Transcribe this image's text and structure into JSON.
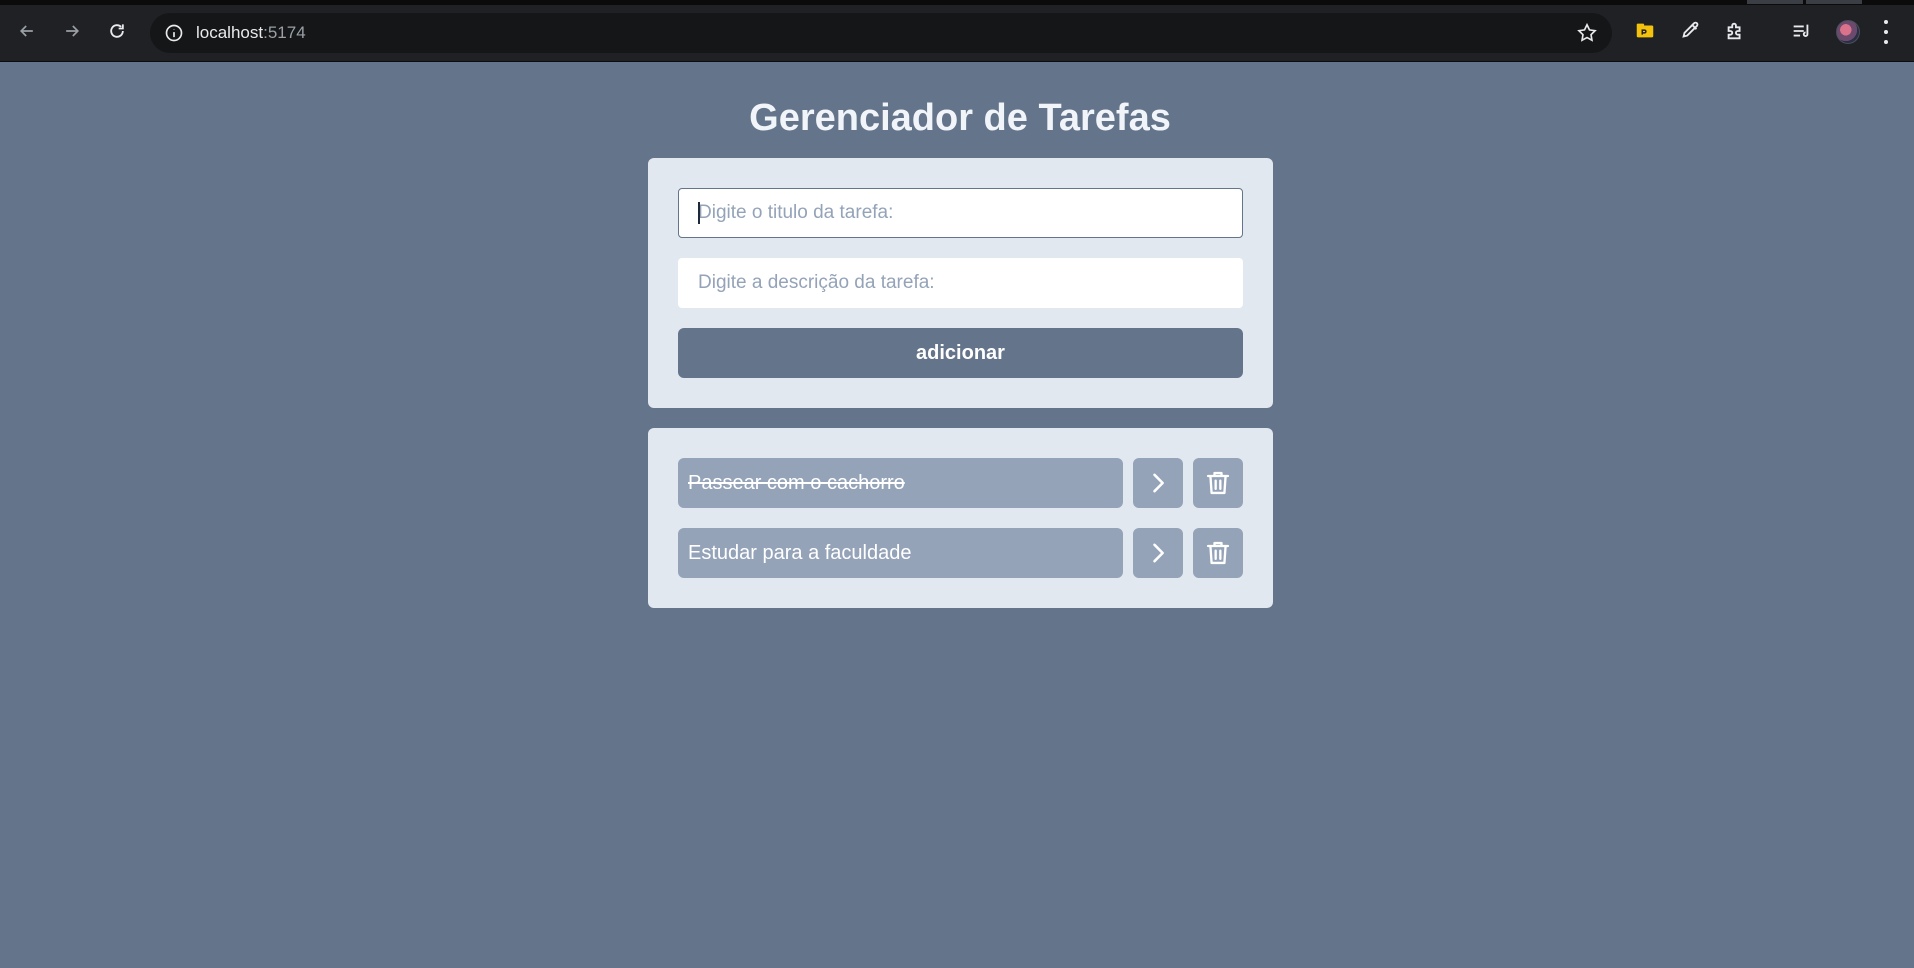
{
  "browser": {
    "url_host": "localhost",
    "url_port": ":5174"
  },
  "app": {
    "title": "Gerenciador de Tarefas",
    "form": {
      "title_placeholder": "Digite o titulo da tarefa:",
      "title_value": "",
      "description_placeholder": "Digite a descrição da tarefa:",
      "description_value": "",
      "add_label": "adicionar"
    },
    "tasks": [
      {
        "title": "Passear com o cachorro",
        "completed": true
      },
      {
        "title": "Estudar para a faculdade",
        "completed": false
      }
    ]
  },
  "colors": {
    "page_background": "#64748b",
    "card_background": "#e2e8f0",
    "task_background": "#94a3b8",
    "button_background": "#64748b",
    "title_text": "#f1f5f9"
  },
  "icons": {
    "toolbar": [
      "back-arrow-icon",
      "forward-arrow-icon",
      "reload-icon",
      "site-info-icon",
      "bookmark-star-icon",
      "extension-folder-icon",
      "eyedropper-icon",
      "extensions-puzzle-icon",
      "media-playlist-icon",
      "profile-avatar",
      "menu-dots-icon"
    ],
    "task_row": [
      "chevron-right-icon",
      "trash-icon"
    ]
  }
}
